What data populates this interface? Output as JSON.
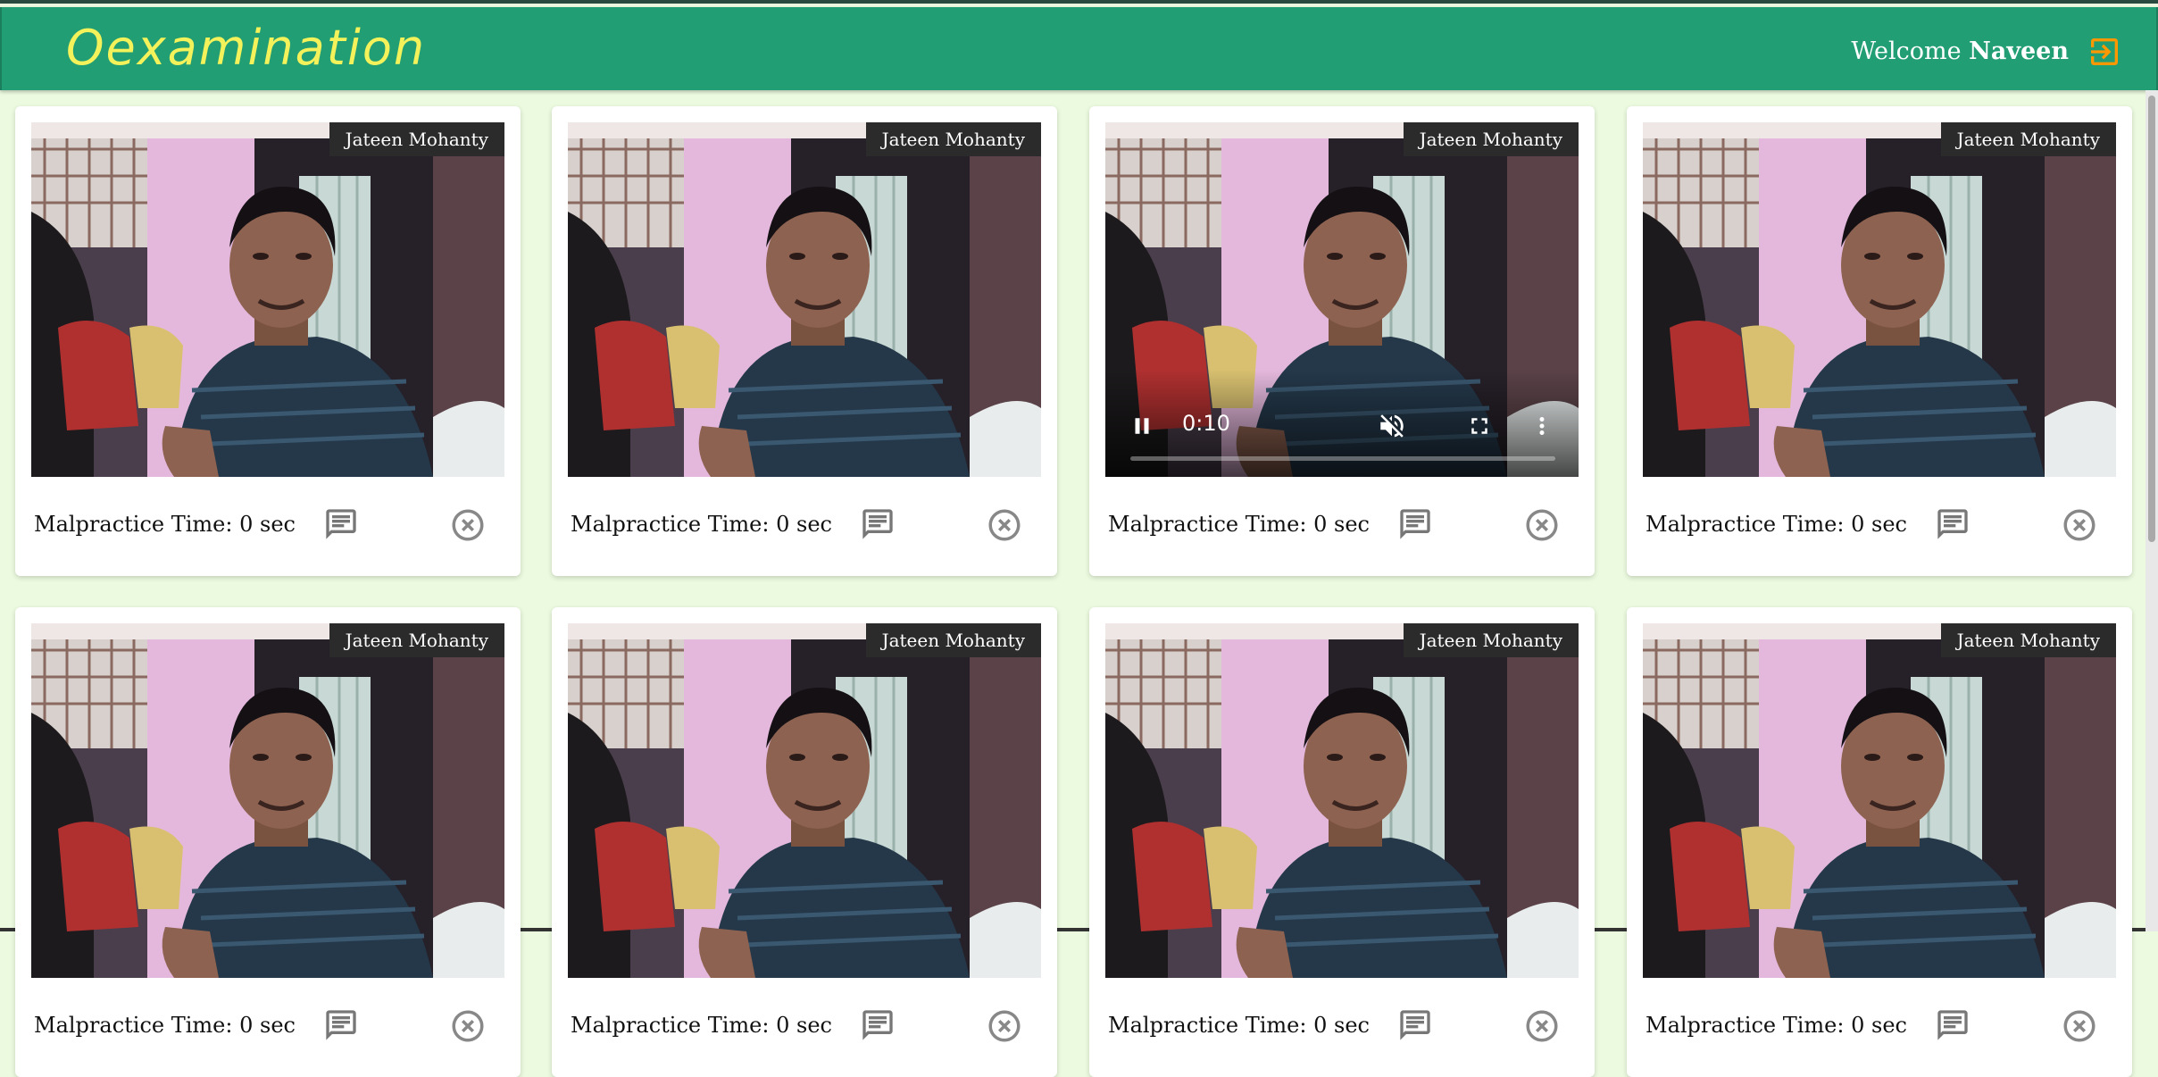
{
  "app": {
    "logo_text": "Oexamination",
    "welcome_prefix": "Welcome",
    "user_name": "Naveen",
    "logout_icon": "logout-icon",
    "header_color": "#229e74",
    "logo_color": "#f4f25a",
    "accent_color": "#ff9800"
  },
  "cards": [
    {
      "name": "Jateen Mohanty",
      "malpractice_label": "Malpractice Time:",
      "malpractice_value": "0 sec",
      "controls_visible": false
    },
    {
      "name": "Jateen Mohanty",
      "malpractice_label": "Malpractice Time:",
      "malpractice_value": "0 sec",
      "controls_visible": false
    },
    {
      "name": "Jateen Mohanty",
      "malpractice_label": "Malpractice Time:",
      "malpractice_value": "0 sec",
      "controls_visible": true,
      "time": "0:10",
      "progress": 0
    },
    {
      "name": "Jateen Mohanty",
      "malpractice_label": "Malpractice Time:",
      "malpractice_value": "0 sec",
      "controls_visible": false
    },
    {
      "name": "Jateen Mohanty",
      "malpractice_label": "Malpractice Time:",
      "malpractice_value": "0 sec",
      "controls_visible": false
    },
    {
      "name": "Jateen Mohanty",
      "malpractice_label": "Malpractice Time:",
      "malpractice_value": "0 sec",
      "controls_visible": false
    },
    {
      "name": "Jateen Mohanty",
      "malpractice_label": "Malpractice Time:",
      "malpractice_value": "0 sec",
      "controls_visible": false
    },
    {
      "name": "Jateen Mohanty",
      "malpractice_label": "Malpractice Time:",
      "malpractice_value": "0 sec",
      "controls_visible": false
    }
  ],
  "icons": {
    "chat": "chat-icon",
    "close": "close-circle-icon",
    "pause": "pause-icon",
    "mute": "volume-off-icon",
    "fullscreen": "fullscreen-icon",
    "more": "more-vert-icon"
  }
}
